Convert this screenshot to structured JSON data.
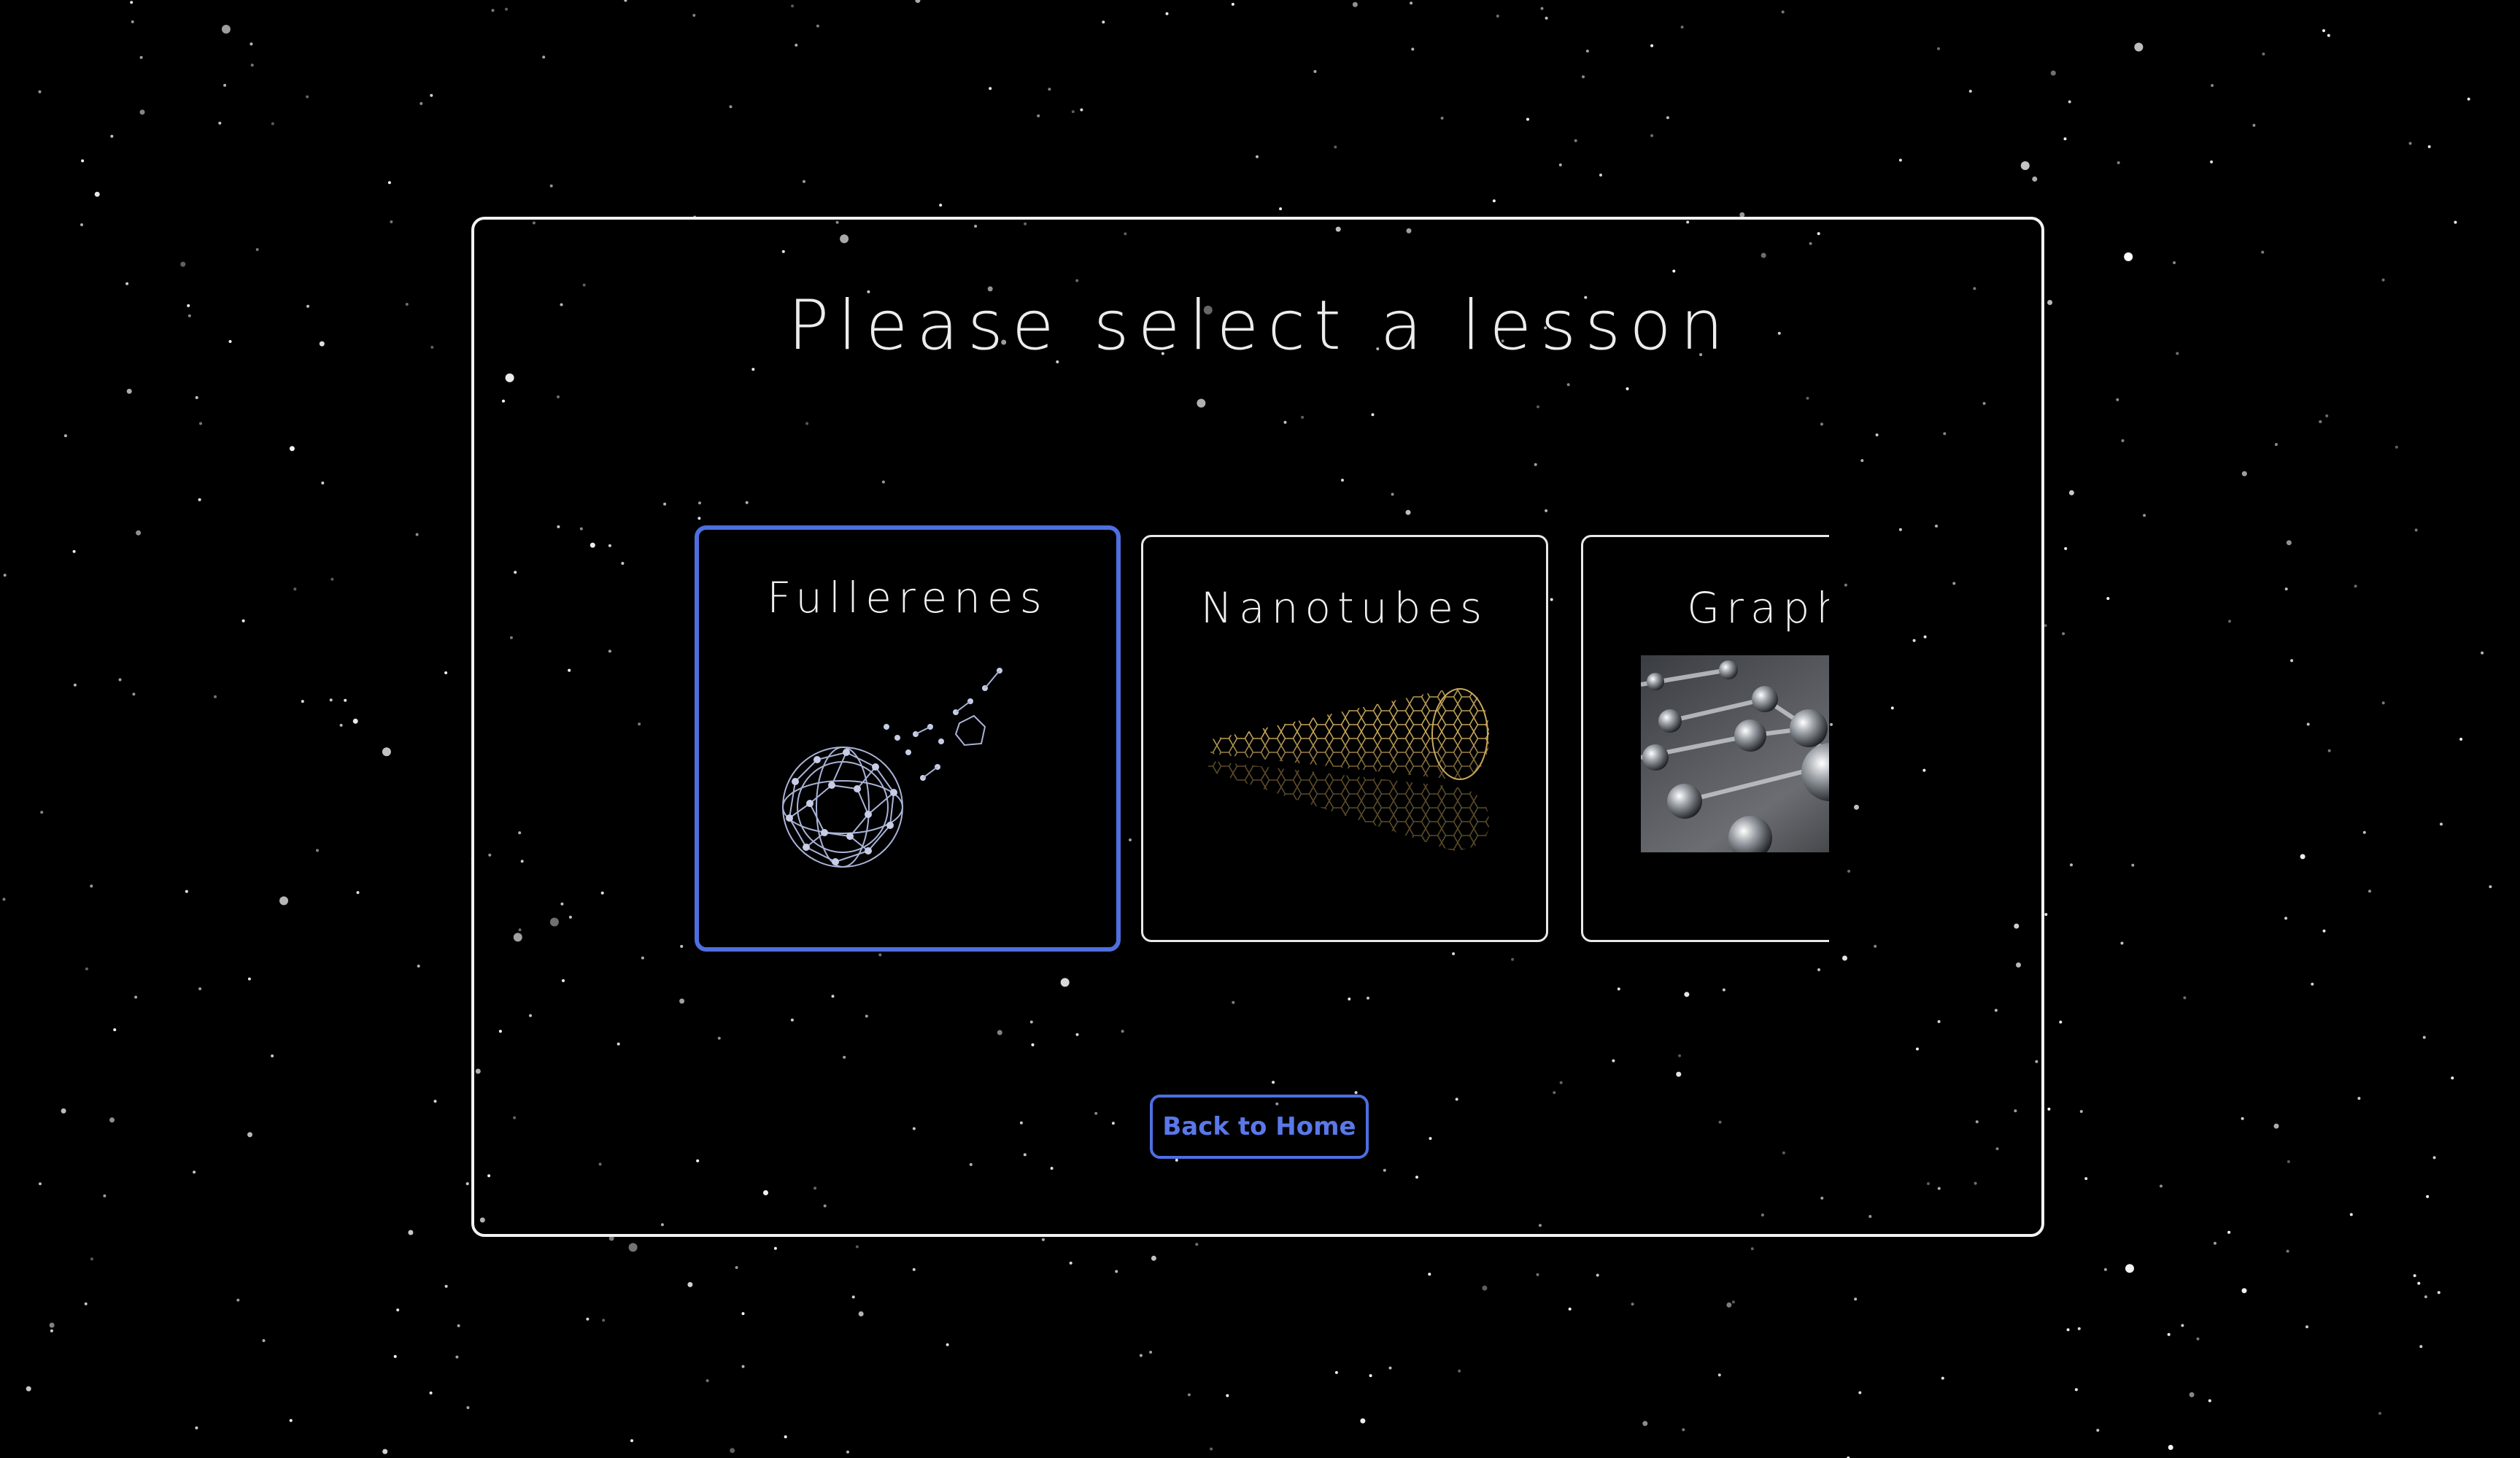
{
  "page": {
    "title": "Please select a lesson"
  },
  "lessons": [
    {
      "label": "Fullerenes",
      "image": "fullerene-molecule-image",
      "selected": true
    },
    {
      "label": "Nanotubes",
      "image": "carbon-nanotube-image",
      "selected": false
    },
    {
      "label": "Graphe",
      "image": "graphene-lattice-image",
      "selected": false
    }
  ],
  "actions": {
    "back_label": "Back to Home"
  },
  "colors": {
    "background": "#000000",
    "accent": "#4e6fe0",
    "text": "#ececec",
    "border": "#f2f2f2"
  }
}
